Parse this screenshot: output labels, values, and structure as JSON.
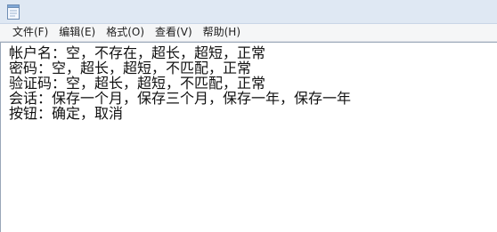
{
  "window": {
    "icon": "notepad-icon"
  },
  "menu": [
    {
      "label": "文件(F)"
    },
    {
      "label": "编辑(E)"
    },
    {
      "label": "格式(O)"
    },
    {
      "label": "查看(V)"
    },
    {
      "label": "帮助(H)"
    }
  ],
  "editor": {
    "lines": [
      "帐户名：空，不存在，超长，超短，正常",
      "密码：空，超长，超短，不匹配，正常",
      "验证码：空，超长，超短，不匹配，正常",
      "会话：保存一个月，保存三个月，保存一年，保存一年",
      "按钮：确定，取消"
    ]
  }
}
